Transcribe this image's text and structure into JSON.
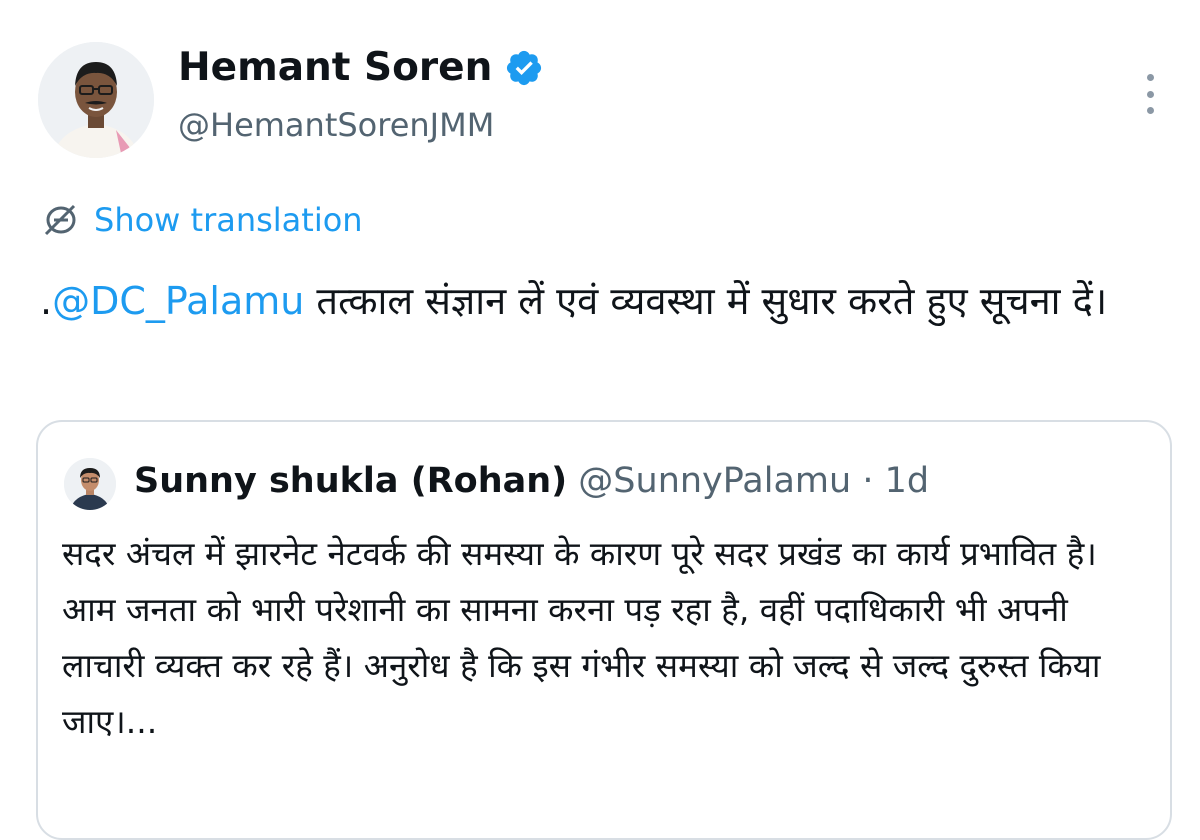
{
  "author": {
    "display_name": "Hemant Soren",
    "handle": "@HemantSorenJMM",
    "verified_icon": "verified-badge-icon",
    "avatar_icon": "profile-photo"
  },
  "menu": {
    "icon": "more-vertical-icon"
  },
  "translation": {
    "label": "Show translation",
    "icon": "translate-icon"
  },
  "tweet": {
    "prefix": ".",
    "mention": "@DC_Palamu",
    "text": " तत्काल संज्ञान लें एवं व्यवस्था में सुधार करते हुए सूचना दें।"
  },
  "quote": {
    "display_name": "Sunny shukla (Rohan)",
    "handle": "@SunnyPalamu",
    "separator": " · ",
    "time": "1d",
    "text": "सदर अंचल में झारनेट नेटवर्क की समस्या के कारण पूरे सदर प्रखंड का कार्य प्रभावित है। आम जनता को भारी परेशानी का सामना करना पड़ रहा है, वहीं पदाधिकारी भी अपनी लाचारी व्यक्त कर रहे हैं। अनुरोध है कि इस गंभीर समस्या को जल्द से जल्द दुरुस्त किया जाए।..."
  },
  "colors": {
    "accent": "#1d9bf0",
    "text": "#0f1419",
    "secondary": "#536471",
    "border": "#d8dee4"
  }
}
